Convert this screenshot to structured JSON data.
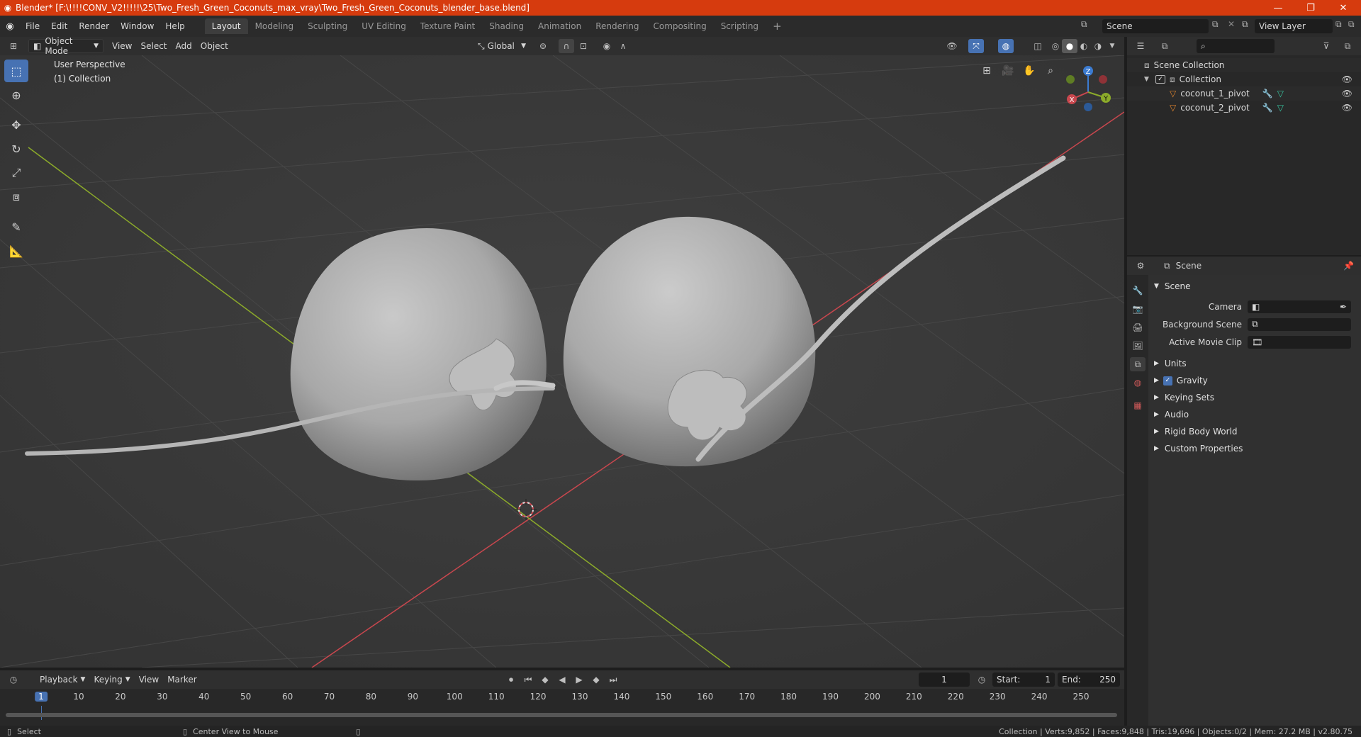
{
  "titlebar": {
    "title": "Blender* [F:\\!!!!CONV_V2!!!!!\\25\\Two_Fresh_Green_Coconuts_max_vray\\Two_Fresh_Green_Coconuts_blender_base.blend]",
    "minimize": "—",
    "maximize": "❐",
    "close": "✕"
  },
  "menubar": {
    "items": [
      "File",
      "Edit",
      "Render",
      "Window",
      "Help"
    ],
    "workspaces": [
      "Layout",
      "Modeling",
      "Sculpting",
      "UV Editing",
      "Texture Paint",
      "Shading",
      "Animation",
      "Rendering",
      "Compositing",
      "Scripting"
    ],
    "active_workspace": "Layout",
    "add_tab": "+",
    "scene": "Scene",
    "view_layer": "View Layer"
  },
  "viewport_header": {
    "mode": "Object Mode",
    "menus": [
      "View",
      "Select",
      "Add",
      "Object"
    ],
    "transform_orientation": "Global"
  },
  "viewport": {
    "perspective_label": "User Perspective",
    "collection_label": "(1) Collection",
    "gizmo": {
      "x": "X",
      "y": "Y",
      "z": "Z"
    }
  },
  "outliner": {
    "root": "Scene Collection",
    "collection": "Collection",
    "objects": [
      "coconut_1_pivot",
      "coconut_2_pivot"
    ]
  },
  "properties": {
    "context": "Scene",
    "panel_title": "Scene",
    "fields": [
      {
        "label": "Camera"
      },
      {
        "label": "Background Scene"
      },
      {
        "label": "Active Movie Clip"
      }
    ],
    "subpanels": [
      "Units",
      "Gravity",
      "Keying Sets",
      "Audio",
      "Rigid Body World",
      "Custom Properties"
    ],
    "gravity_checked": true
  },
  "timeline": {
    "menus": [
      "Playback",
      "Keying",
      "View",
      "Marker"
    ],
    "current_frame": "1",
    "start_label": "Start:",
    "start": "1",
    "end_label": "End:",
    "end": "250",
    "ticks": [
      "1",
      "10",
      "20",
      "30",
      "40",
      "50",
      "60",
      "70",
      "80",
      "90",
      "100",
      "110",
      "120",
      "130",
      "140",
      "150",
      "160",
      "170",
      "180",
      "190",
      "200",
      "210",
      "220",
      "230",
      "240",
      "250"
    ]
  },
  "statusbar": {
    "left_action": "Select",
    "mid_action": "Center View to Mouse",
    "stats": "Collection | Verts:9,852 | Faces:9,848 | Tris:19,696 | Objects:0/2 | Mem: 27.2 MB | v2.80.75"
  },
  "colors": {
    "titlebar": "#d63b0e",
    "accent": "#4772b3",
    "x_axis": "#c9474e",
    "y_axis": "#8cab2a",
    "z_axis": "#3b7bd1"
  }
}
